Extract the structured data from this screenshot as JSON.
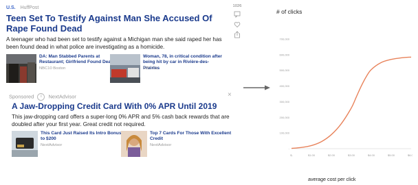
{
  "article": {
    "category": "U.S.",
    "source": "HuffPost",
    "headline": "Teen Set To Testify Against Man She Accused Of Rape Found Dead",
    "summary": "A teenager who had been set to testify against a Michigan man she said raped her has been found dead in what police are investigating as a homicide.",
    "share_count": "1026",
    "related": [
      {
        "title": "DA: Man Stabbed Parents at Restaurant; Girlfriend Found Dead",
        "source": "NBC10 Boston"
      },
      {
        "title": "Woman, 78, in critical condition after being hit by car in Rivière-des-Prairies",
        "source": "CBC.Ca"
      }
    ]
  },
  "ad": {
    "sponsored_label": "Sponsored",
    "info_label": "i",
    "advertiser": "NextAdvisor",
    "close_label": "×",
    "headline": "A Jaw-Dropping Credit Card With 0% APR Until 2019",
    "summary": "This jaw-dropping card offers a super-long 0% APR and 5% cash back rewards that are doubled after your first year. Great credit not required.",
    "related": [
      {
        "title": "This Card Just Raised Its Intro Bonus to $200",
        "source": "NextAdvisor"
      },
      {
        "title": "Top 7 Cards For Those With Excellent Credit",
        "source": "NextAdvisor"
      }
    ]
  },
  "icons": {
    "comment": "comment-icon",
    "heart": "heart-icon",
    "share": "share-icon",
    "arrow": "arrow-right-icon"
  },
  "colors": {
    "headline": "#1a3a8c",
    "category": "#3a64c8",
    "curve": "#e8825a"
  },
  "chart_labels": {
    "ylabel": "# of clicks",
    "xlabel": "average cost per click"
  },
  "chart_data": {
    "type": "line",
    "ylabel": "# of clicks",
    "xlabel": "average cost per click",
    "xlim": [
      0,
      6
    ],
    "ylim": [
      0,
      700000
    ],
    "x_ticks": [
      "$-",
      "$1.00",
      "$2.00",
      "$3.00",
      "$4.00",
      "$5.00",
      "$6.00"
    ],
    "y_ticks": [
      "-",
      "100,000",
      "200,000",
      "300,000",
      "400,000",
      "500,000",
      "600,000",
      "700,000"
    ],
    "grid": false,
    "series": [
      {
        "x": [
          0,
          0.5,
          1.0,
          1.5,
          2.0,
          2.5,
          3.0,
          3.25,
          3.5,
          3.75,
          4.0,
          4.5,
          5.0,
          5.5,
          6.0
        ],
        "y": [
          2000,
          8000,
          20000,
          45000,
          90000,
          160000,
          260000,
          330000,
          400000,
          460000,
          505000,
          550000,
          570000,
          580000,
          585000
        ]
      }
    ]
  }
}
